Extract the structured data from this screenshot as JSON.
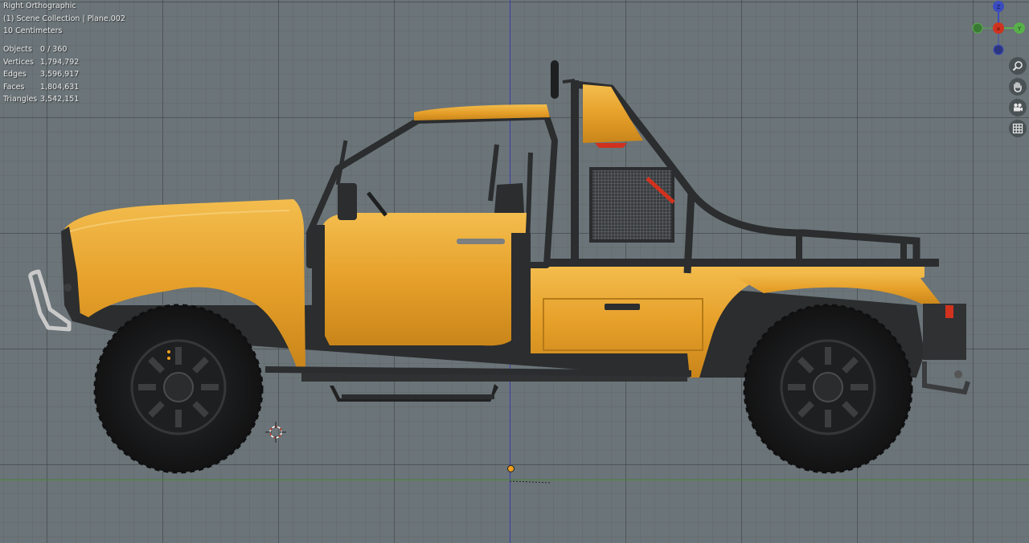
{
  "viewport": {
    "view_name": "Right Orthographic",
    "collection_info": "(1) Scene Collection | Plane.002",
    "scale_info": "10 Centimeters"
  },
  "stats": [
    {
      "label": "Objects",
      "value": "0 / 360"
    },
    {
      "label": "Vertices",
      "value": "1,794,792"
    },
    {
      "label": "Edges",
      "value": "3,596,917"
    },
    {
      "label": "Faces",
      "value": "1,804,631"
    },
    {
      "label": "Triangles",
      "value": "3,542,151"
    }
  ],
  "navigation": {
    "gizmo_icon": "axis-gizmo-icon",
    "buttons": [
      {
        "icon": "zoom-icon"
      },
      {
        "icon": "hand-pan-icon"
      },
      {
        "icon": "camera-icon"
      },
      {
        "icon": "grid-icon"
      }
    ]
  },
  "colors": {
    "body_yellow": "#e8a32a",
    "frame_dark": "#2b2d2e",
    "tire": "#1c1d1e",
    "accent_red": "#d0321e",
    "axis_blue": "#3a3fa8",
    "axis_green": "#4f8a3a"
  }
}
